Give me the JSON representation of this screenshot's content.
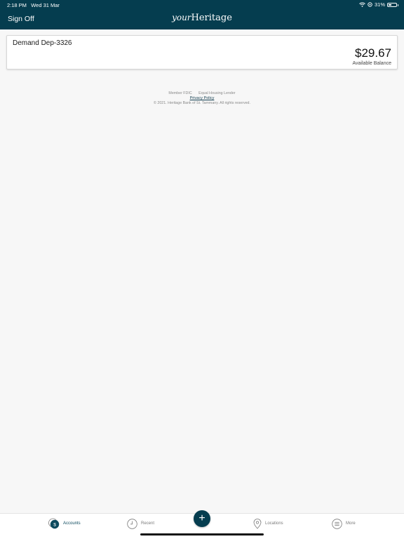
{
  "status_bar": {
    "time": "2:18 PM",
    "date": "Wed 31 Mar",
    "battery": "31%"
  },
  "header": {
    "sign_off": "Sign Off",
    "logo_your": "your",
    "logo_heritage": "Heritage"
  },
  "account": {
    "name": "Demand Dep-3326",
    "balance": "$29.67",
    "balance_label": "Available Balance"
  },
  "footer": {
    "member_fdic": "Member FDIC",
    "equal_housing": "Equal Housing Lender",
    "privacy": "Privacy Policy",
    "copyright": "© 2021. Heritage Bank of St. Tammany. All rights reserved."
  },
  "tabbar": {
    "accounts": "Accounts",
    "recent": "Recent",
    "add": "+",
    "locations": "Locations",
    "more": "More",
    "accounts_icon_glyph": "$"
  },
  "colors": {
    "brand": "#053d4f",
    "background": "#f7f7f7",
    "active_tab": "#0d4a5e"
  }
}
